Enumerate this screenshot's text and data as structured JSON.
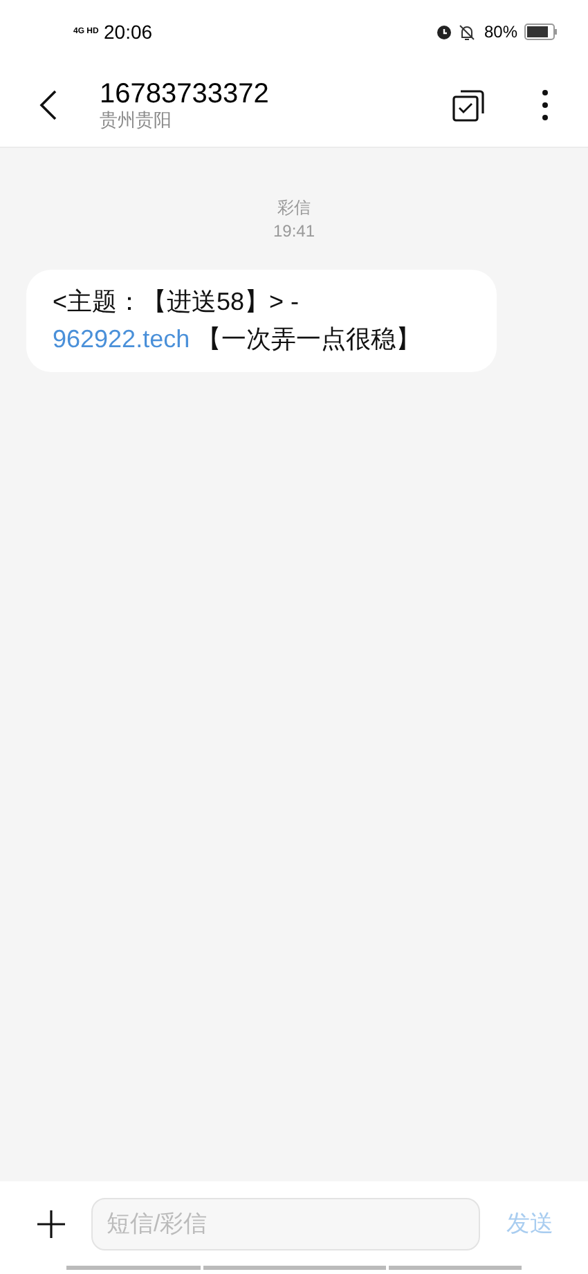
{
  "status_bar": {
    "network": "4G HD",
    "time": "20:06",
    "battery": "80%"
  },
  "header": {
    "title": "16783733372",
    "subtitle": "贵州贵阳"
  },
  "messages": [
    {
      "type": "彩信",
      "time": "19:41",
      "text_before": "<主题：【进送58】> -",
      "link": "962922.tech",
      "text_after": " 【一次弄一点很稳】"
    }
  ],
  "composer": {
    "placeholder": "短信/彩信",
    "send": "发送",
    "send_disabled": true
  }
}
